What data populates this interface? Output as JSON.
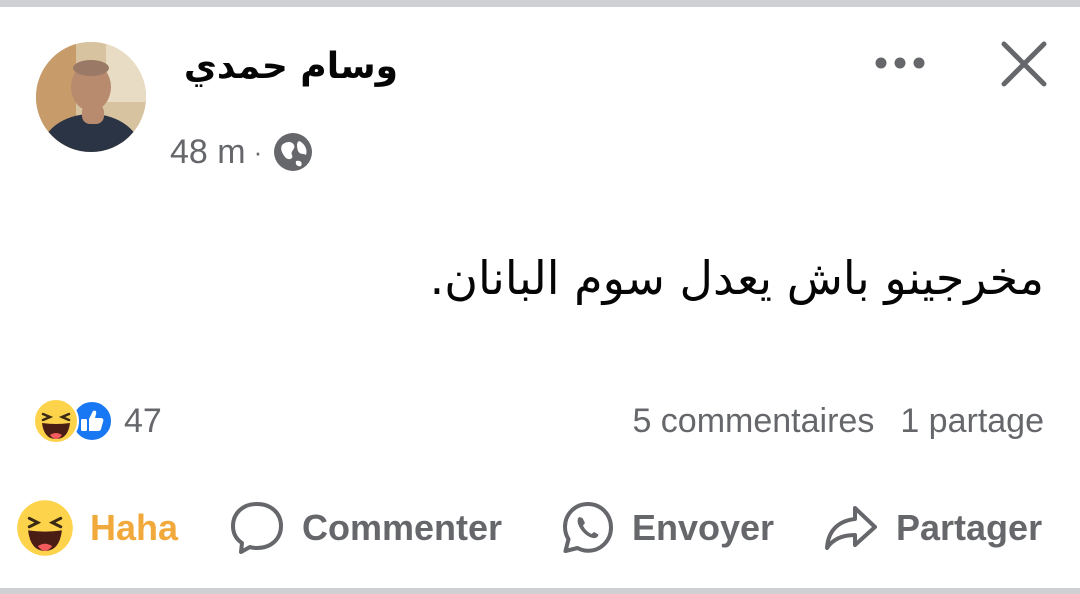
{
  "post": {
    "author": "وسام حمدي",
    "time": "48 m",
    "separator": "·",
    "privacy_icon": "globe-icon",
    "text": "مخرجينو باش يعدل سوم البانان."
  },
  "header_icons": [
    "more-options-icon",
    "close-icon"
  ],
  "engagement": {
    "reaction_icons": [
      "haha-reaction-icon",
      "like-reaction-icon"
    ],
    "reaction_count": "47",
    "comments": "5 commentaires",
    "shares": "1 partage"
  },
  "actions": {
    "reaction_label": "Haha",
    "comment_label": "Commenter",
    "send_label": "Envoyer",
    "share_label": "Partager"
  },
  "colors": {
    "haha_active": "#f2a93b",
    "secondary_text": "#65676b",
    "like_blue": "#1877f2",
    "divider": "#ced0d4"
  }
}
